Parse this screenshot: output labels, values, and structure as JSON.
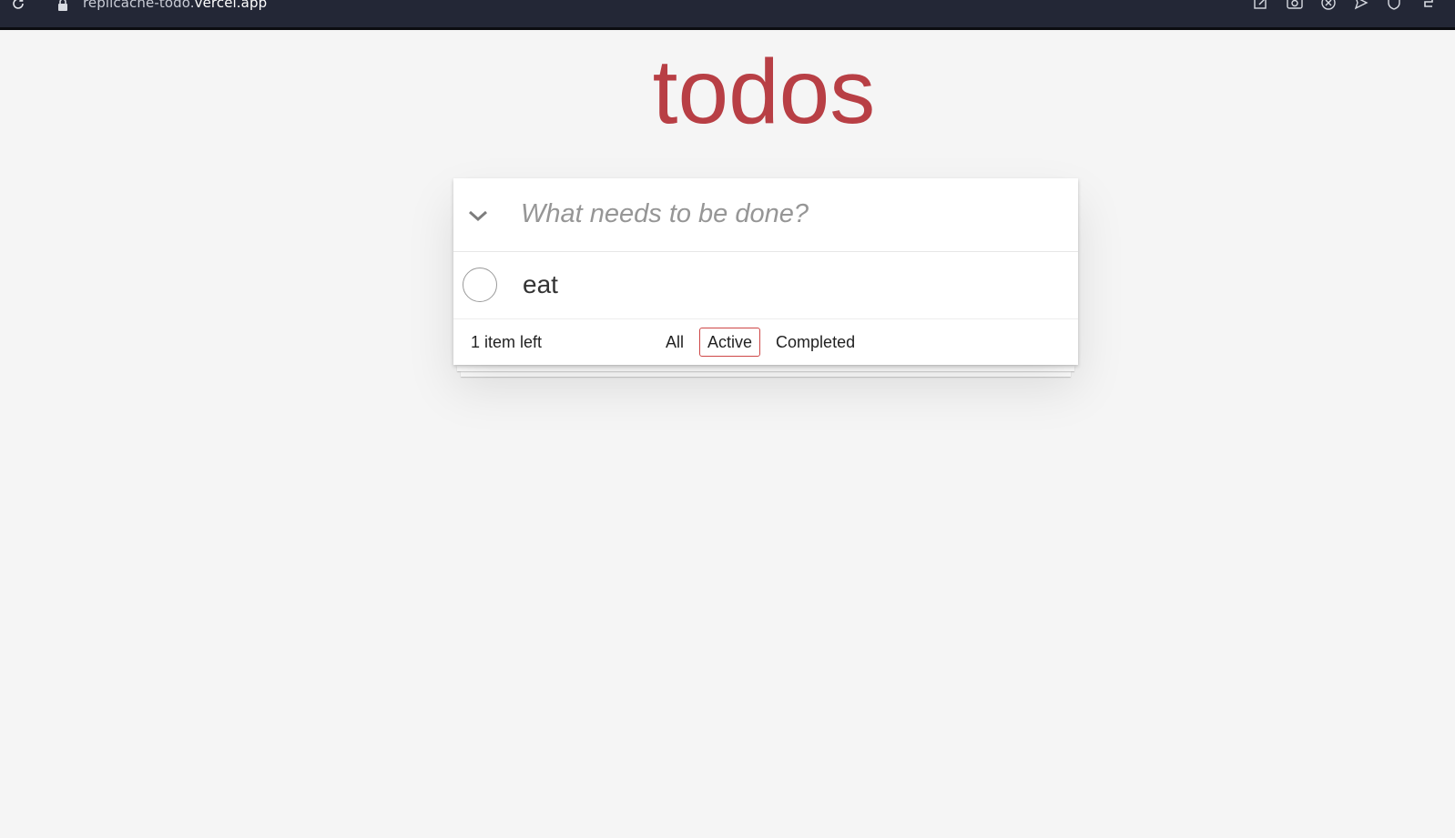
{
  "browser": {
    "url_path": "replicache-todo.",
    "url_host": "vercel.app",
    "icons": [
      "reload-icon",
      "lock-icon",
      "edit-icon",
      "camera-icon",
      "x-circle-icon",
      "send-icon",
      "shield-icon"
    ]
  },
  "app": {
    "title": "todos",
    "new_todo_placeholder": "What needs to be done?",
    "todos": [
      {
        "label": "eat",
        "completed": false
      }
    ],
    "footer": {
      "count_text": "1 item left",
      "filters": [
        "All",
        "Active",
        "Completed"
      ],
      "selected_filter": "Active"
    },
    "colors": {
      "title": "#b83f45",
      "selected_filter_border": "#ce4646",
      "background": "#f5f5f5"
    }
  }
}
